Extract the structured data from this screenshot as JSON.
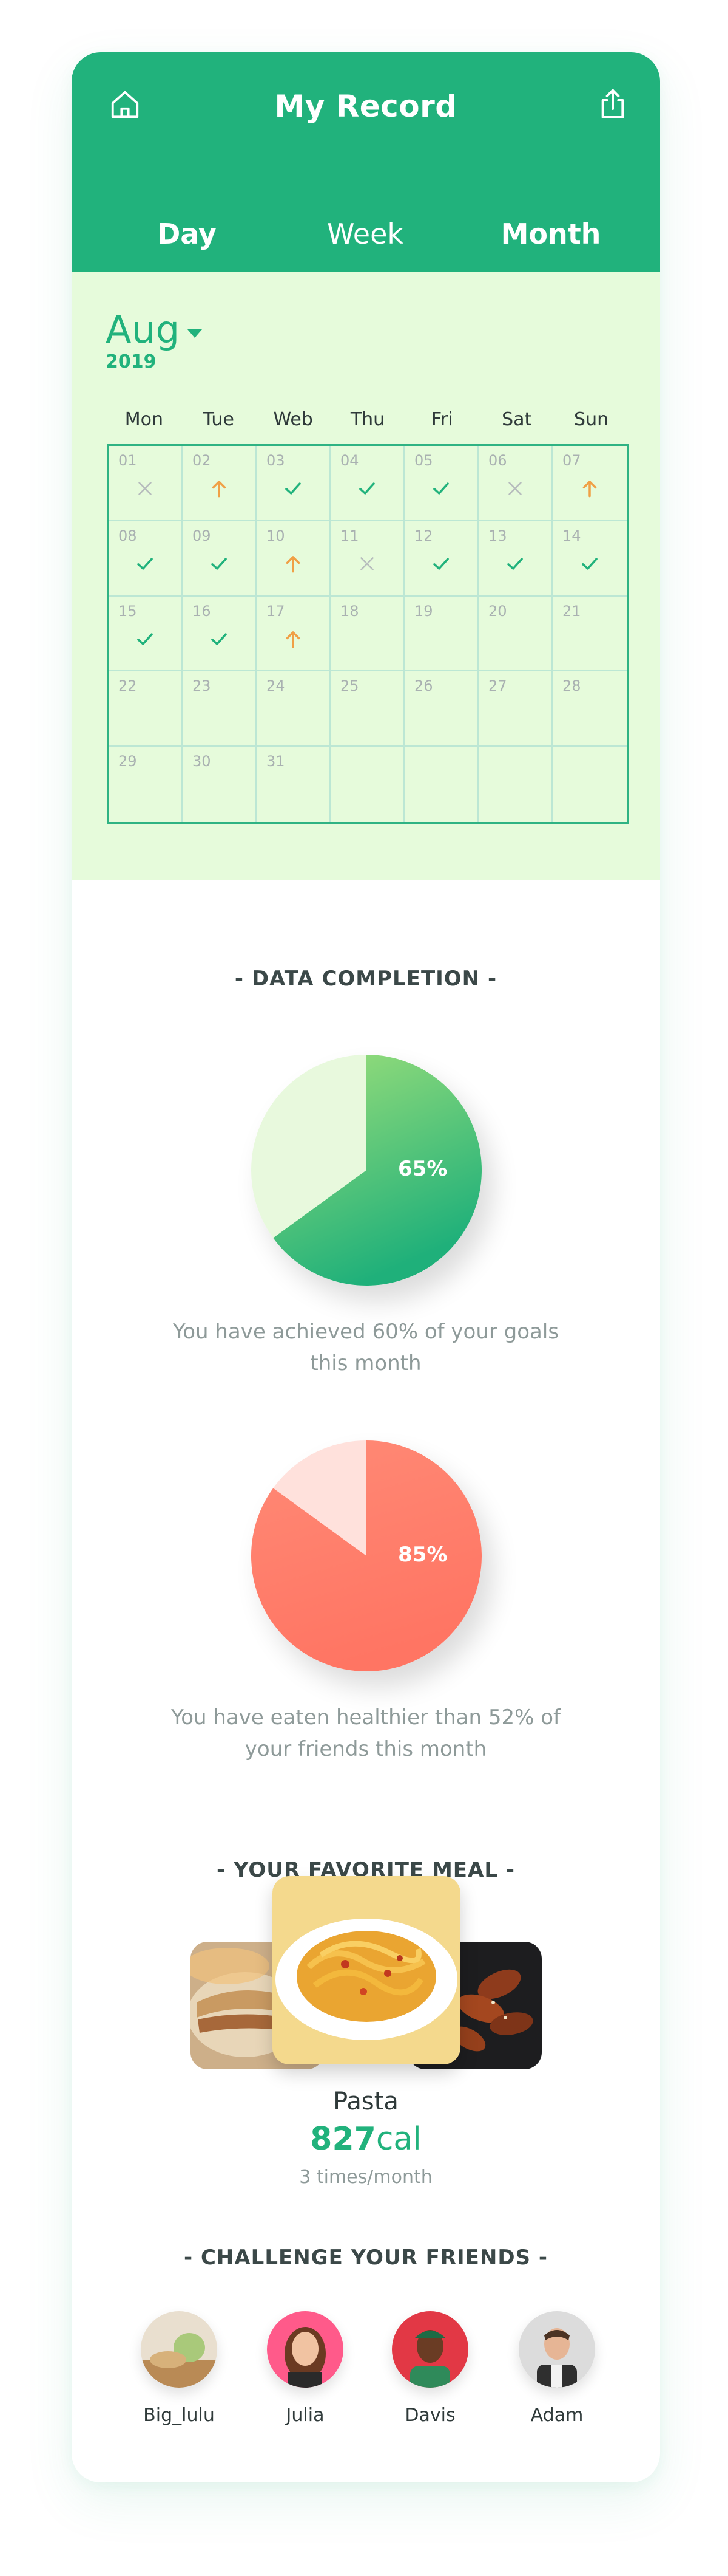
{
  "header": {
    "title": "My Record",
    "home_icon": "home-icon",
    "share_icon": "share-icon",
    "tabs": [
      {
        "label": "Day"
      },
      {
        "label": "Week"
      },
      {
        "label": "Month",
        "active": true
      }
    ]
  },
  "calendar": {
    "month": "Aug",
    "year": "2019",
    "weekdays": [
      "Mon",
      "Tue",
      "Web",
      "Thu",
      "Fri",
      "Sat",
      "Sun"
    ],
    "days": [
      {
        "num": "01",
        "status": "missed"
      },
      {
        "num": "02",
        "status": "up"
      },
      {
        "num": "03",
        "status": "done"
      },
      {
        "num": "04",
        "status": "done"
      },
      {
        "num": "05",
        "status": "done"
      },
      {
        "num": "06",
        "status": "missed"
      },
      {
        "num": "07",
        "status": "up"
      },
      {
        "num": "08",
        "status": "done"
      },
      {
        "num": "09",
        "status": "done"
      },
      {
        "num": "10",
        "status": "up"
      },
      {
        "num": "11",
        "status": "missed"
      },
      {
        "num": "12",
        "status": "done"
      },
      {
        "num": "13",
        "status": "done"
      },
      {
        "num": "14",
        "status": "done"
      },
      {
        "num": "15",
        "status": "done"
      },
      {
        "num": "16",
        "status": "done"
      },
      {
        "num": "17",
        "status": "up"
      },
      {
        "num": "18",
        "status": ""
      },
      {
        "num": "19",
        "status": ""
      },
      {
        "num": "20",
        "status": ""
      },
      {
        "num": "21",
        "status": ""
      },
      {
        "num": "22",
        "status": ""
      },
      {
        "num": "23",
        "status": ""
      },
      {
        "num": "24",
        "status": ""
      },
      {
        "num": "25",
        "status": ""
      },
      {
        "num": "26",
        "status": ""
      },
      {
        "num": "27",
        "status": ""
      },
      {
        "num": "28",
        "status": ""
      },
      {
        "num": "29",
        "status": ""
      },
      {
        "num": "30",
        "status": ""
      },
      {
        "num": "31",
        "status": ""
      },
      {
        "num": "",
        "status": ""
      },
      {
        "num": "",
        "status": ""
      },
      {
        "num": "",
        "status": ""
      },
      {
        "num": "",
        "status": ""
      }
    ]
  },
  "data_completion": {
    "title": "- DATA COMPLETION -",
    "goal_pie": {
      "label": "65%",
      "value": 0.65
    },
    "goal_caption": "You have achieved 60% of your goals this month",
    "friends_pie": {
      "label": "85%",
      "value": 0.85
    },
    "friends_caption": "You have eaten healthier than 52% of your friends this month"
  },
  "favorite_meal": {
    "title": "- YOUR FAVORITE MEAL -",
    "name": "Pasta",
    "cal_value": "827",
    "cal_unit": "cal",
    "frequency": "3 times/month"
  },
  "challenge": {
    "title": "- CHALLENGE YOUR FRIENDS -",
    "friends": [
      {
        "name": "Big_lulu"
      },
      {
        "name": "Julia"
      },
      {
        "name": "Davis"
      },
      {
        "name": "Adam"
      }
    ]
  },
  "colors": {
    "accent": "#21b27c",
    "calendar_bg": "#e6fbdb",
    "up_arrow": "#f0a046",
    "missed": "#b7bdbd",
    "pie_green_dark": "#21b27c",
    "pie_green_light": "#e8f9dd",
    "pie_red": "#ff7b69",
    "pie_red_light": "#ffe1dc"
  }
}
